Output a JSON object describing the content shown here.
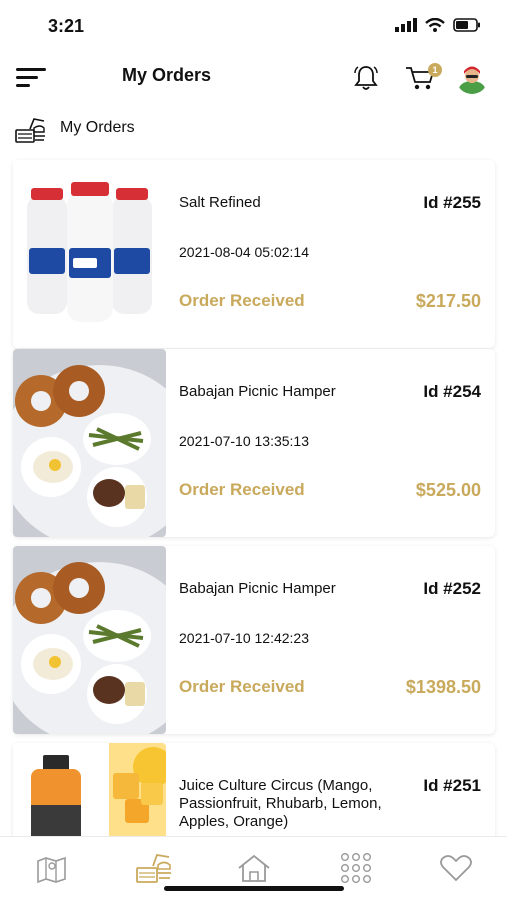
{
  "status_bar": {
    "time": "3:21"
  },
  "header": {
    "title": "My Orders",
    "cart_badge": "1"
  },
  "section": {
    "label": "My Orders"
  },
  "orders": [
    {
      "name": "Salt Refined",
      "id": "Id #255",
      "date": "2021-08-04 05:02:14",
      "status": "Order Received",
      "price": "$217.50",
      "image": "salt-bottles"
    },
    {
      "name": "Babajan Picnic Hamper",
      "id": "Id #254",
      "date": "2021-07-10 13:35:13",
      "status": "Order Received",
      "price": "$525.00",
      "image": "picnic-platter"
    },
    {
      "name": "Babajan Picnic Hamper",
      "id": "Id #252",
      "date": "2021-07-10 12:42:23",
      "status": "Order Received",
      "price": "$1398.50",
      "image": "picnic-platter"
    },
    {
      "name": "Juice Culture Circus (Mango, Passionfruit, Rhubarb, Lemon, Apples, Orange)",
      "id": "Id #251",
      "image": "juice-bottles"
    }
  ],
  "bottom_nav": [
    "map-icon",
    "orders-icon",
    "home-icon",
    "categories-icon",
    "heart-icon"
  ],
  "colors": {
    "accent": "#c9a95c",
    "text": "#111111",
    "background": "#ffffff"
  }
}
